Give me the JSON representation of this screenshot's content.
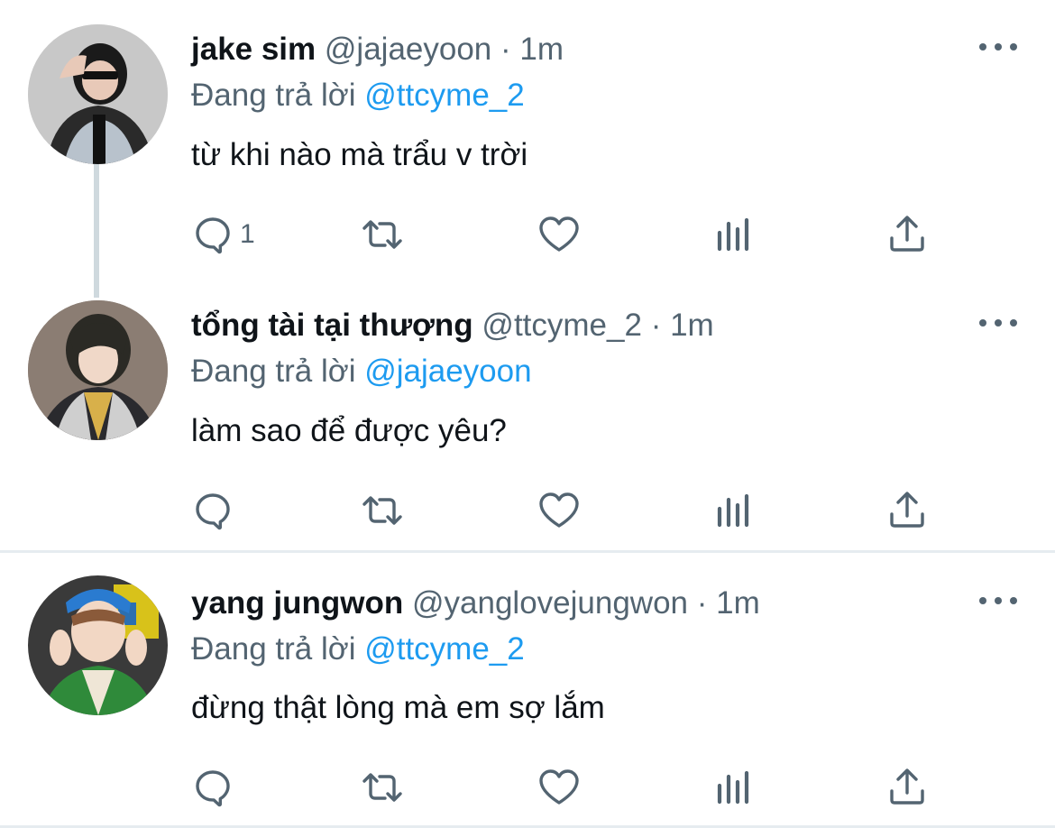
{
  "tweets": [
    {
      "name": "jake sim",
      "handle": "@jajaeyoon",
      "separator": "·",
      "time": "1m",
      "replying_prefix": "Đang trả lời",
      "replying_to": "@ttcyme_2",
      "text": "từ khi nào mà trẩu v trời",
      "reply_count": "1",
      "avatar_desc": "person-with-sunglasses-icon"
    },
    {
      "name": "tổng tài tại thượng",
      "handle": "@ttcyme_2",
      "separator": "·",
      "time": "1m",
      "replying_prefix": "Đang trả lời",
      "replying_to": "@jajaeyoon",
      "text": "làm sao để được yêu?",
      "reply_count": "",
      "avatar_desc": "anime-character-icon"
    },
    {
      "name": "yang jungwon",
      "handle": "@yanglovejungwon",
      "separator": "·",
      "time": "1m",
      "replying_prefix": "Đang trả lời",
      "replying_to": "@ttcyme_2",
      "text": "đừng thật lòng mà em sợ lắm",
      "reply_count": "",
      "avatar_desc": "person-peace-sign-icon"
    }
  ],
  "colors": {
    "text": "#0f1419",
    "secondary": "#536471",
    "link": "#1d9bf0",
    "divider": "#e6ecf0",
    "thread_line": "#cfd9de"
  }
}
